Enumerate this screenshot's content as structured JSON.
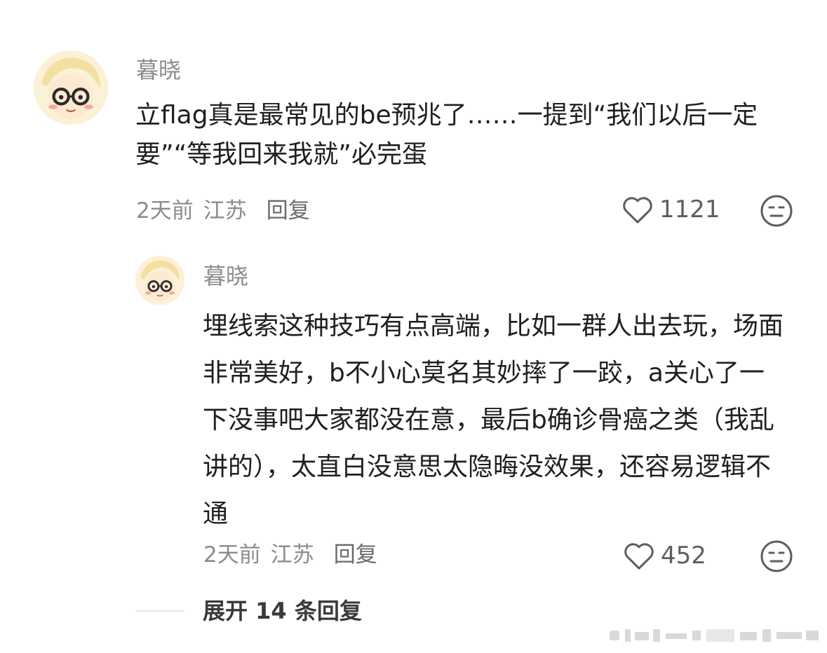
{
  "comment": {
    "user_name": "暮晓",
    "text": "立flag真是最常见的be预兆了……一提到“我们以后一定要”“等我回来我就”必完蛋",
    "time": "2天前",
    "location": "江苏",
    "reply_label": "回复",
    "likes": "1121"
  },
  "reply": {
    "user_name": "暮晓",
    "text": "埋线索这种技巧有点高端，比如一群人出去玩，场面非常美好，b不小心莫名其妙摔了一跤，a关心了一下没事吧大家都没在意，最后b确诊骨癌之类（我乱讲的），太直白没意思太隐晦没效果，还容易逻辑不通",
    "time": "2天前",
    "location": "江苏",
    "reply_label": "回复",
    "likes": "452"
  },
  "expand_label": "展开 14 条回复",
  "icons": {
    "like": "heart-outline-icon",
    "dislike": "neutral-face-icon"
  },
  "colors": {
    "secondary_text": "#8c8c8c",
    "primary_text": "#1f1f1f"
  }
}
